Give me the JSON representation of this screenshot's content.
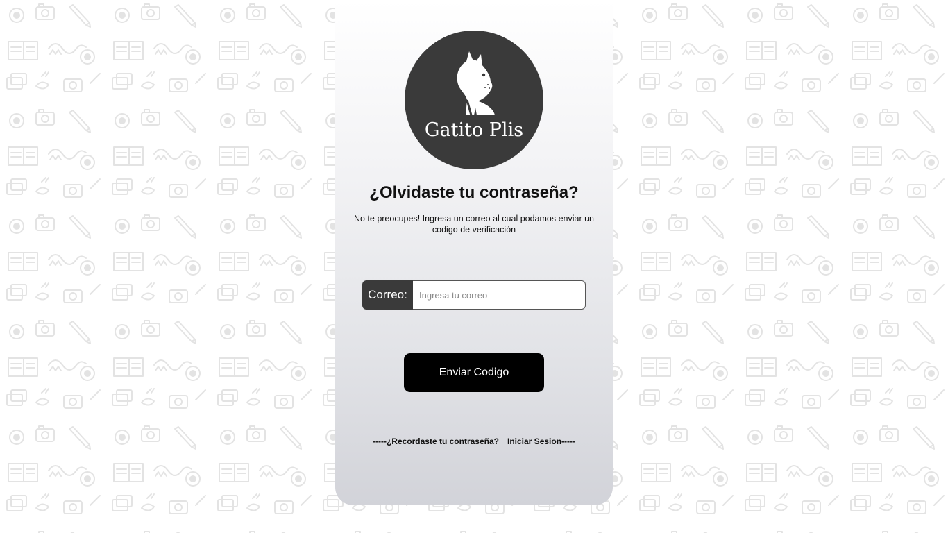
{
  "brand": {
    "name": "Gatito Plis",
    "logo_icon": "cat-silhouette-icon",
    "logo_bg_color": "#3a3a3a"
  },
  "page": {
    "title": "¿Olvidaste tu contraseña?",
    "subtitle": "No te preocupes! Ingresa un correo al cual podamos enviar un codigo de verificación"
  },
  "form": {
    "email_label": "Correo:",
    "email_value": "",
    "email_placeholder": "Ingresa tu correo",
    "submit_label": "Enviar Codigo"
  },
  "footer": {
    "remember_text": "-----¿Recordaste tu contraseña?",
    "login_link": "Iniciar Sesion-----"
  },
  "background": {
    "pattern_icons": [
      "camera-icon",
      "pencil-icon",
      "book-icon",
      "target-icon",
      "cat-doodle-icon"
    ]
  }
}
